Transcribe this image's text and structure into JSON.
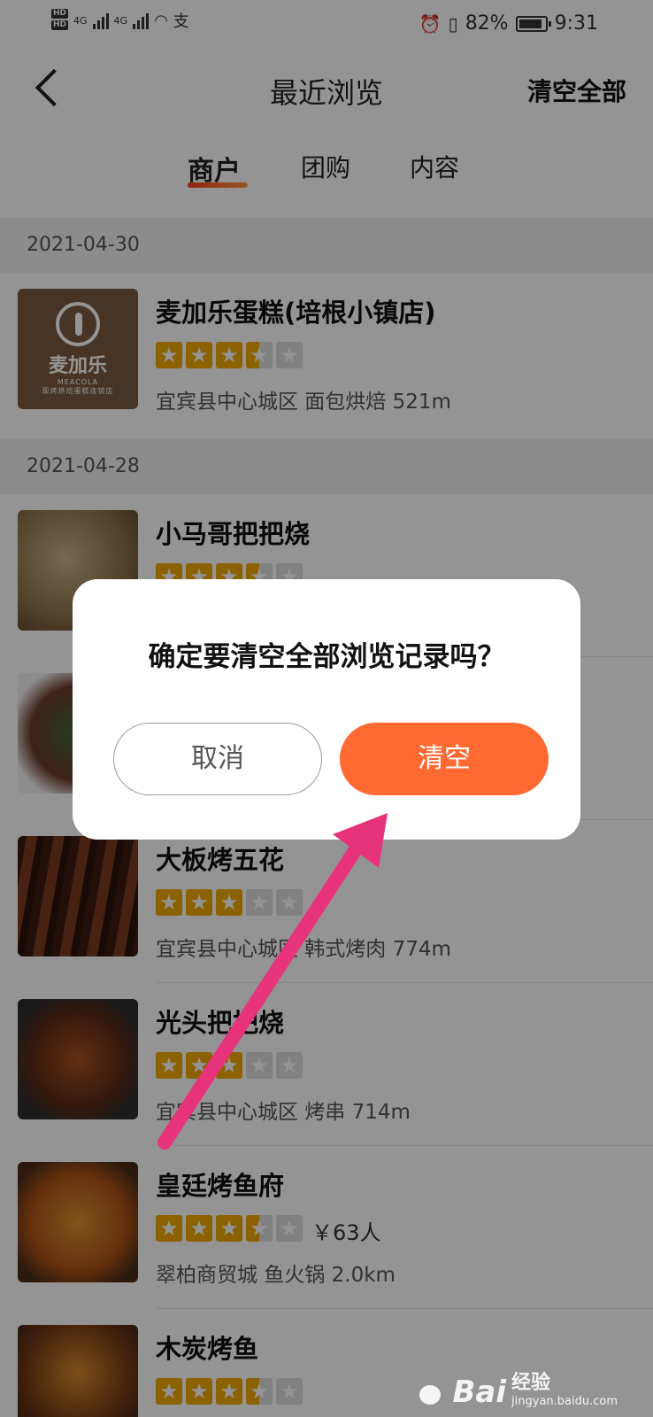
{
  "status_bar": {
    "hd_top": "HD",
    "hd_bottom": "HD",
    "net1": "4G",
    "net2": "4G",
    "extra_icon": "支",
    "battery_percent": "82%",
    "time": "9:31"
  },
  "nav": {
    "title": "最近浏览",
    "clear_all_label": "清空全部"
  },
  "tabs": [
    {
      "label": "商户",
      "active": true
    },
    {
      "label": "团购",
      "active": false
    },
    {
      "label": "内容",
      "active": false
    }
  ],
  "sections": [
    {
      "date": "2021-04-30"
    },
    {
      "date": "2021-04-28"
    }
  ],
  "merchants": [
    {
      "name": "麦加乐蛋糕(培根小镇店)",
      "rating": 3.5,
      "meta": "宜宾县中心城区 面包烘焙   521m",
      "price": "",
      "logo_text": "麦加乐",
      "logo_sub": "MEACOLA",
      "logo_caption": "现烤烘焙蛋糕连锁店"
    },
    {
      "name": "小马哥把把烧",
      "rating": 3.5,
      "meta": "",
      "price": ""
    },
    {
      "name": "",
      "rating": 0,
      "meta": "",
      "price": ""
    },
    {
      "name": "大板烤五花",
      "rating": 3,
      "meta": "宜宾县中心城区 韩式烤肉   774m",
      "price": ""
    },
    {
      "name": "光头把把烧",
      "rating": 3,
      "meta": "宜宾县中心城区 烤串   714m",
      "price": ""
    },
    {
      "name": "皇廷烤鱼府",
      "rating": 3.5,
      "meta": "翠柏商贸城 鱼火锅   2.0km",
      "price": "￥63人"
    },
    {
      "name": "木炭烤鱼",
      "rating": 3.5,
      "meta": "",
      "price": ""
    }
  ],
  "dialog": {
    "title": "确定要清空全部浏览记录吗？",
    "cancel_label": "取消",
    "confirm_label": "清空"
  },
  "annotation_arrow_color": "#e6337a",
  "accent_color": "#ff6a33",
  "watermark": {
    "brand": "Bai",
    "cn": "经验",
    "url": "jingyan.baidu.com"
  }
}
